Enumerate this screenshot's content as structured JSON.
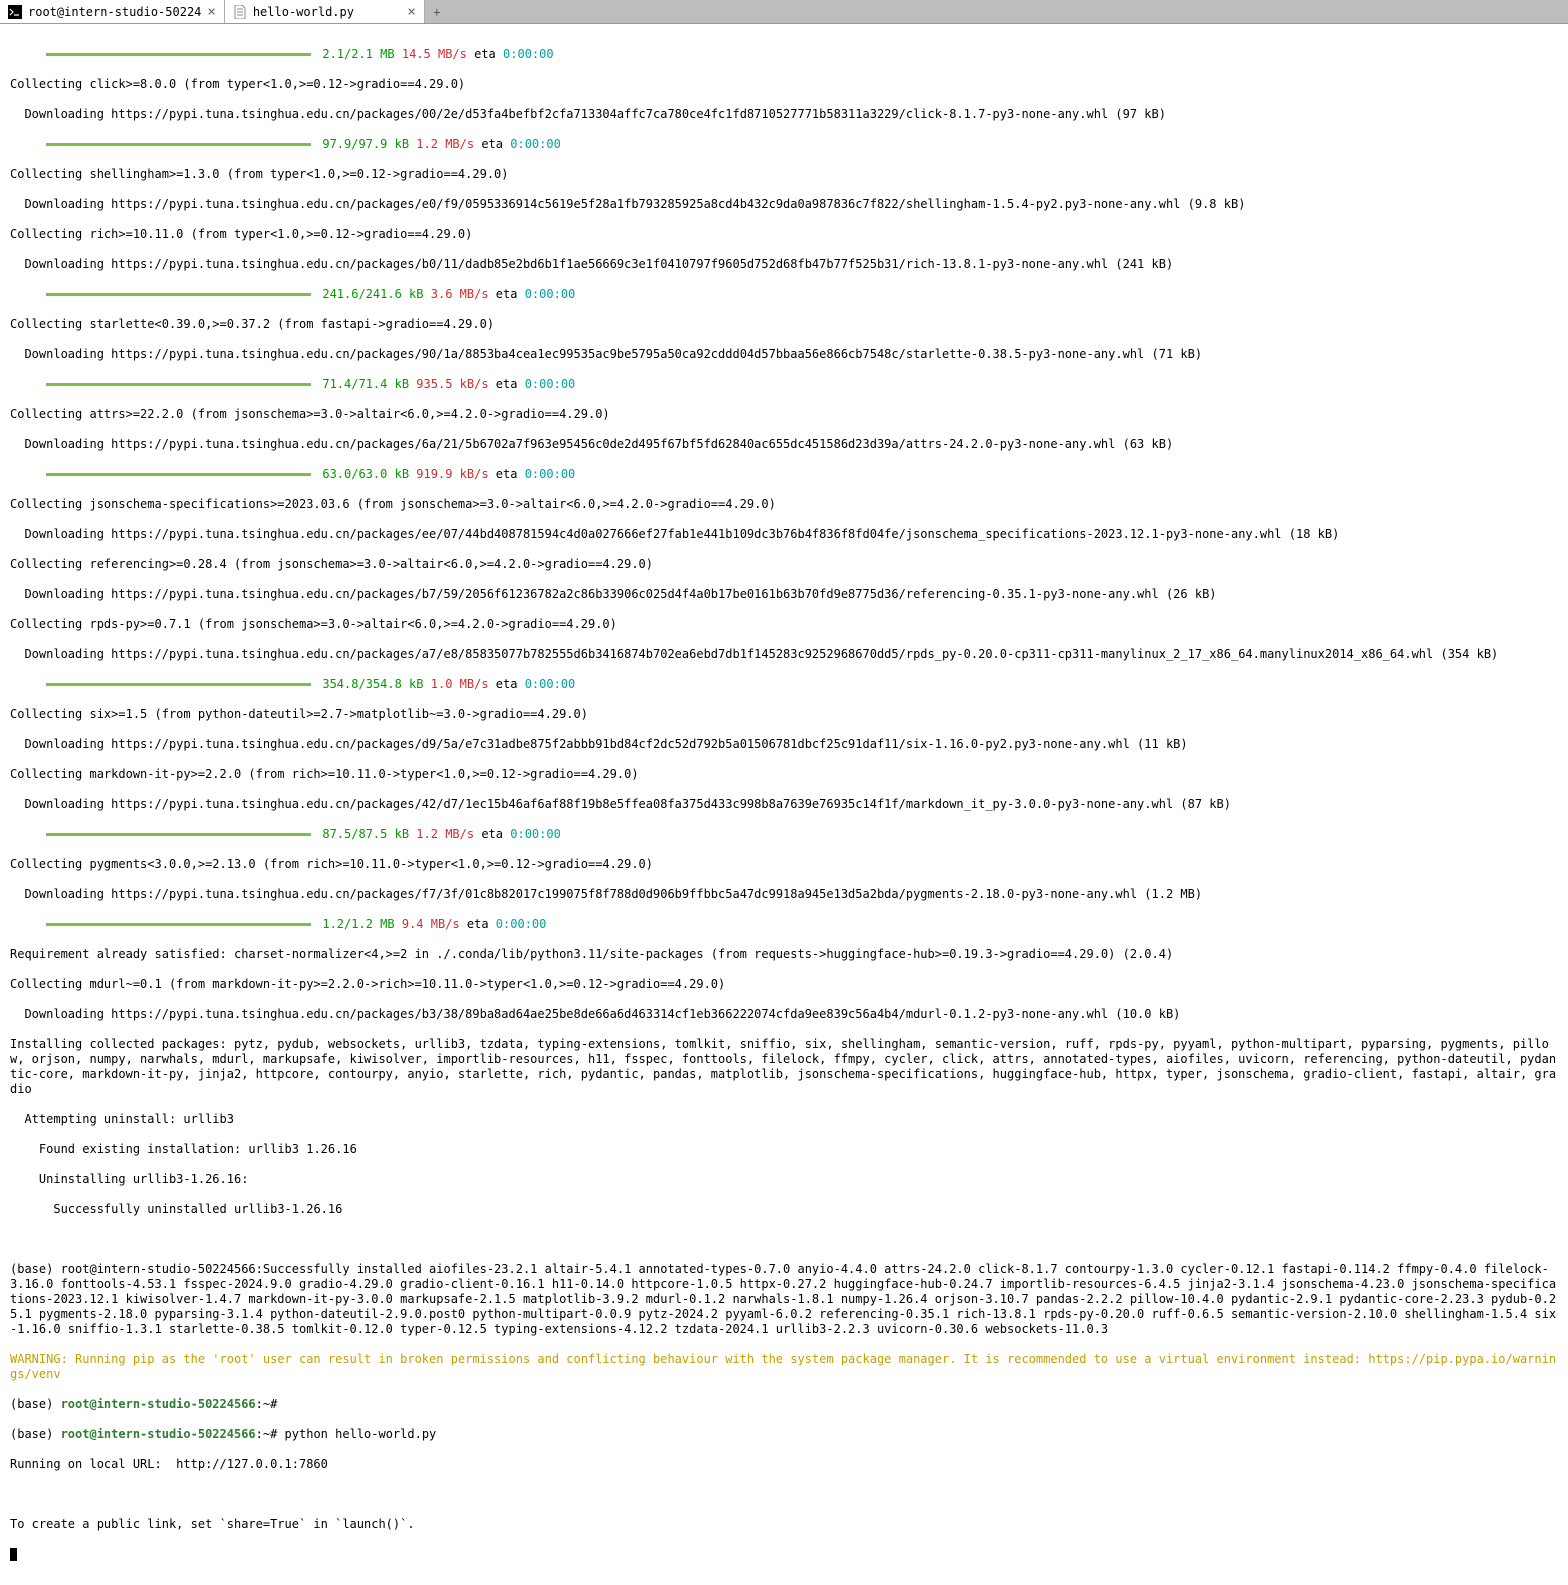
{
  "tabs": [
    {
      "label": "root@intern-studio-50224",
      "icon": "terminal-icon"
    },
    {
      "label": "hello-world.py",
      "icon": "file-icon"
    }
  ],
  "progress": [
    {
      "size": "2.1/2.1 MB",
      "rate": "14.5 MB/s",
      "eta": "0:00:00"
    },
    {
      "size": "97.9/97.9 kB",
      "rate": "1.2 MB/s",
      "eta": "0:00:00"
    },
    {
      "size": "241.6/241.6 kB",
      "rate": "3.6 MB/s",
      "eta": "0:00:00"
    },
    {
      "size": "71.4/71.4 kB",
      "rate": "935.5 kB/s",
      "eta": "0:00:00"
    },
    {
      "size": "63.0/63.0 kB",
      "rate": "919.9 kB/s",
      "eta": "0:00:00"
    },
    {
      "size": "354.8/354.8 kB",
      "rate": "1.0 MB/s",
      "eta": "0:00:00"
    },
    {
      "size": "87.5/87.5 kB",
      "rate": "1.2 MB/s",
      "eta": "0:00:00"
    },
    {
      "size": "1.2/1.2 MB",
      "rate": "9.4 MB/s",
      "eta": "0:00:00"
    }
  ],
  "lines": {
    "l1": "Collecting click>=8.0.0 (from typer<1.0,>=0.12->gradio==4.29.0)",
    "l2": "  Downloading https://pypi.tuna.tsinghua.edu.cn/packages/00/2e/d53fa4befbf2cfa713304affc7ca780ce4fc1fd8710527771b58311a3229/click-8.1.7-py3-none-any.whl (97 kB)",
    "l3": "Collecting shellingham>=1.3.0 (from typer<1.0,>=0.12->gradio==4.29.0)",
    "l4": "  Downloading https://pypi.tuna.tsinghua.edu.cn/packages/e0/f9/0595336914c5619e5f28a1fb793285925a8cd4b432c9da0a987836c7f822/shellingham-1.5.4-py2.py3-none-any.whl (9.8 kB)",
    "l5": "Collecting rich>=10.11.0 (from typer<1.0,>=0.12->gradio==4.29.0)",
    "l6": "  Downloading https://pypi.tuna.tsinghua.edu.cn/packages/b0/11/dadb85e2bd6b1f1ae56669c3e1f0410797f9605d752d68fb47b77f525b31/rich-13.8.1-py3-none-any.whl (241 kB)",
    "l7": "Collecting starlette<0.39.0,>=0.37.2 (from fastapi->gradio==4.29.0)",
    "l8": "  Downloading https://pypi.tuna.tsinghua.edu.cn/packages/90/1a/8853ba4cea1ec99535ac9be5795a50ca92cddd04d57bbaa56e866cb7548c/starlette-0.38.5-py3-none-any.whl (71 kB)",
    "l9": "Collecting attrs>=22.2.0 (from jsonschema>=3.0->altair<6.0,>=4.2.0->gradio==4.29.0)",
    "l10": "  Downloading https://pypi.tuna.tsinghua.edu.cn/packages/6a/21/5b6702a7f963e95456c0de2d495f67bf5fd62840ac655dc451586d23d39a/attrs-24.2.0-py3-none-any.whl (63 kB)",
    "l11": "Collecting jsonschema-specifications>=2023.03.6 (from jsonschema>=3.0->altair<6.0,>=4.2.0->gradio==4.29.0)",
    "l12": "  Downloading https://pypi.tuna.tsinghua.edu.cn/packages/ee/07/44bd408781594c4d0a027666ef27fab1e441b109dc3b76b4f836f8fd04fe/jsonschema_specifications-2023.12.1-py3-none-any.whl (18 kB)",
    "l13": "Collecting referencing>=0.28.4 (from jsonschema>=3.0->altair<6.0,>=4.2.0->gradio==4.29.0)",
    "l14": "  Downloading https://pypi.tuna.tsinghua.edu.cn/packages/b7/59/2056f61236782a2c86b33906c025d4f4a0b17be0161b63b70fd9e8775d36/referencing-0.35.1-py3-none-any.whl (26 kB)",
    "l15": "Collecting rpds-py>=0.7.1 (from jsonschema>=3.0->altair<6.0,>=4.2.0->gradio==4.29.0)",
    "l16": "  Downloading https://pypi.tuna.tsinghua.edu.cn/packages/a7/e8/85835077b782555d6b3416874b702ea6ebd7db1f145283c9252968670dd5/rpds_py-0.20.0-cp311-cp311-manylinux_2_17_x86_64.manylinux2014_x86_64.whl (354 kB)",
    "l17": "Collecting six>=1.5 (from python-dateutil>=2.7->matplotlib~=3.0->gradio==4.29.0)",
    "l18": "  Downloading https://pypi.tuna.tsinghua.edu.cn/packages/d9/5a/e7c31adbe875f2abbb91bd84cf2dc52d792b5a01506781dbcf25c91daf11/six-1.16.0-py2.py3-none-any.whl (11 kB)",
    "l19": "Collecting markdown-it-py>=2.2.0 (from rich>=10.11.0->typer<1.0,>=0.12->gradio==4.29.0)",
    "l20": "  Downloading https://pypi.tuna.tsinghua.edu.cn/packages/42/d7/1ec15b46af6af88f19b8e5ffea08fa375d433c998b8a7639e76935c14f1f/markdown_it_py-3.0.0-py3-none-any.whl (87 kB)",
    "l21": "Collecting pygments<3.0.0,>=2.13.0 (from rich>=10.11.0->typer<1.0,>=0.12->gradio==4.29.0)",
    "l22": "  Downloading https://pypi.tuna.tsinghua.edu.cn/packages/f7/3f/01c8b82017c199075f8f788d0d906b9ffbbc5a47dc9918a945e13d5a2bda/pygments-2.18.0-py3-none-any.whl (1.2 MB)",
    "l23": "Requirement already satisfied: charset-normalizer<4,>=2 in ./.conda/lib/python3.11/site-packages (from requests->huggingface-hub>=0.19.3->gradio==4.29.0) (2.0.4)",
    "l24": "Collecting mdurl~=0.1 (from markdown-it-py>=2.2.0->rich>=10.11.0->typer<1.0,>=0.12->gradio==4.29.0)",
    "l25": "  Downloading https://pypi.tuna.tsinghua.edu.cn/packages/b3/38/89ba8ad64ae25be8de66a6d463314cf1eb366222074cfda9ee839c56a4b4/mdurl-0.1.2-py3-none-any.whl (10.0 kB)",
    "l26": "Installing collected packages: pytz, pydub, websockets, urllib3, tzdata, typing-extensions, tomlkit, sniffio, six, shellingham, semantic-version, ruff, rpds-py, pyyaml, python-multipart, pyparsing, pygments, pillow, orjson, numpy, narwhals, mdurl, markupsafe, kiwisolver, importlib-resources, h11, fsspec, fonttools, filelock, ffmpy, cycler, click, attrs, annotated-types, aiofiles, uvicorn, referencing, python-dateutil, pydantic-core, markdown-it-py, jinja2, httpcore, contourpy, anyio, starlette, rich, pydantic, pandas, matplotlib, jsonschema-specifications, huggingface-hub, httpx, typer, jsonschema, gradio-client, fastapi, altair, gradio",
    "l27": "  Attempting uninstall: urllib3",
    "l28": "    Found existing installation: urllib3 1.26.16",
    "l29": "    Uninstalling urllib3-1.26.16:",
    "l30": "      Successfully uninstalled urllib3-1.26.16",
    "l31": "(base) root@intern-studio-50224566:Successfully installed aiofiles-23.2.1 altair-5.4.1 annotated-types-0.7.0 anyio-4.4.0 attrs-24.2.0 click-8.1.7 contourpy-1.3.0 cycler-0.12.1 fastapi-0.114.2 ffmpy-0.4.0 filelock-3.16.0 fonttools-4.53.1 fsspec-2024.9.0 gradio-4.29.0 gradio-client-0.16.1 h11-0.14.0 httpcore-1.0.5 httpx-0.27.2 huggingface-hub-0.24.7 importlib-resources-6.4.5 jinja2-3.1.4 jsonschema-4.23.0 jsonschema-specifications-2023.12.1 kiwisolver-1.4.7 markdown-it-py-3.0.0 markupsafe-2.1.5 matplotlib-3.9.2 mdurl-0.1.2 narwhals-1.8.1 numpy-1.26.4 orjson-3.10.7 pandas-2.2.2 pillow-10.4.0 pydantic-2.9.1 pydantic-core-2.23.3 pydub-0.25.1 pygments-2.18.0 pyparsing-3.1.4 python-dateutil-2.9.0.post0 python-multipart-0.0.9 pytz-2024.2 pyyaml-6.0.2 referencing-0.35.1 rich-13.8.1 rpds-py-0.20.0 ruff-0.6.5 semantic-version-2.10.0 shellingham-1.5.4 six-1.16.0 sniffio-1.3.1 starlette-0.38.5 tomlkit-0.12.0 typer-0.12.5 typing-extensions-4.12.2 tzdata-2024.1 urllib3-2.2.3 uvicorn-0.30.6 websockets-11.0.3",
    "warn": "WARNING: Running pip as the 'root' user can result in broken permissions and conflicting behaviour with the system package manager. It is recommended to use a virtual environment instead: https://pip.pypa.io/warnings/venv",
    "p1env": "(base) ",
    "p1user": "root@intern-studio-50224566",
    "p1rest": ":~# ",
    "p2env": "(base) ",
    "p2user": "root@intern-studio-50224566",
    "p2rest": ":~# python hello-world.py",
    "l32": "Running on local URL:  http://127.0.0.1:7860",
    "l33": "To create a public link, set `share=True` in `launch()`.",
    "eta_label": "eta"
  }
}
